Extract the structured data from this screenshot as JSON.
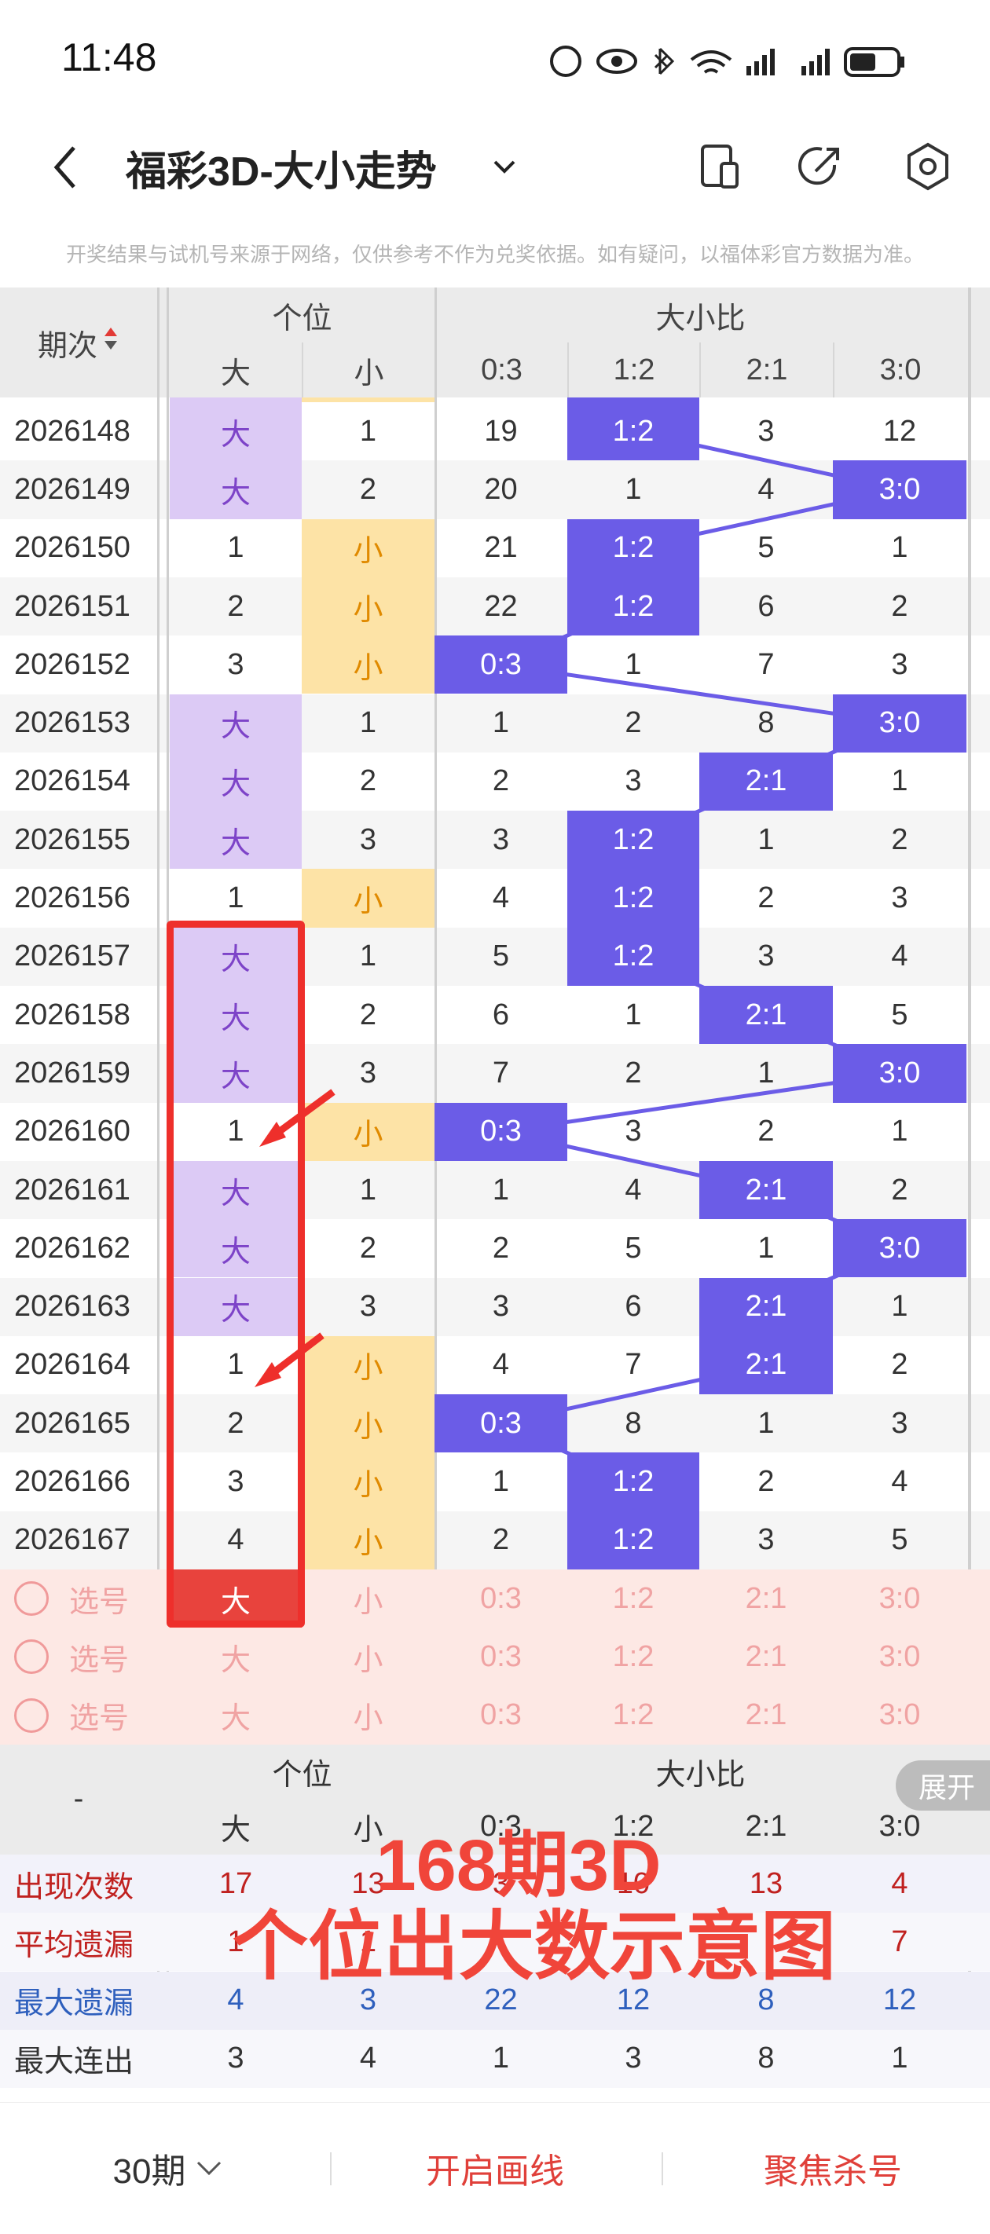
{
  "status_bar": {
    "time": "11:48"
  },
  "nav": {
    "title": "福彩3D-大小走势",
    "back_icon": "chevron-left-icon",
    "icons": [
      "phone-icon",
      "share-icon",
      "settings-hex-icon"
    ]
  },
  "notice": "开奖结果与试机号来源于网络，仅供参考不作为兑奖依据。如有疑问，以福体彩官方数据为准。",
  "table": {
    "period_header": "期次",
    "group_headers": [
      "个位",
      "大小比"
    ],
    "sub_headers": [
      "大",
      "小",
      "0:3",
      "1:2",
      "2:1",
      "3:0"
    ],
    "rows": [
      {
        "period": "2026148",
        "big": "大",
        "small": "1",
        "r03": "19",
        "r12": "1:2",
        "r21": "3",
        "r30": "12",
        "hit": 1
      },
      {
        "period": "2026149",
        "big": "大",
        "small": "2",
        "r03": "20",
        "r12": "1",
        "r21": "4",
        "r30": "3:0",
        "hit": 3
      },
      {
        "period": "2026150",
        "big": "1",
        "small": "小",
        "r03": "21",
        "r12": "1:2",
        "r21": "5",
        "r30": "1",
        "hit": 1
      },
      {
        "period": "2026151",
        "big": "2",
        "small": "小",
        "r03": "22",
        "r12": "1:2",
        "r21": "6",
        "r30": "2",
        "hit": 1
      },
      {
        "period": "2026152",
        "big": "3",
        "small": "小",
        "r03": "0:3",
        "r12": "1",
        "r21": "7",
        "r30": "3",
        "hit": 0
      },
      {
        "period": "2026153",
        "big": "大",
        "small": "1",
        "r03": "1",
        "r12": "2",
        "r21": "8",
        "r30": "3:0",
        "hit": 3
      },
      {
        "period": "2026154",
        "big": "大",
        "small": "2",
        "r03": "2",
        "r12": "3",
        "r21": "2:1",
        "r30": "1",
        "hit": 2
      },
      {
        "period": "2026155",
        "big": "大",
        "small": "3",
        "r03": "3",
        "r12": "1:2",
        "r21": "1",
        "r30": "2",
        "hit": 1
      },
      {
        "period": "2026156",
        "big": "1",
        "small": "小",
        "r03": "4",
        "r12": "1:2",
        "r21": "2",
        "r30": "3",
        "hit": 1
      },
      {
        "period": "2026157",
        "big": "大",
        "small": "1",
        "r03": "5",
        "r12": "1:2",
        "r21": "3",
        "r30": "4",
        "hit": 1
      },
      {
        "period": "2026158",
        "big": "大",
        "small": "2",
        "r03": "6",
        "r12": "1",
        "r21": "2:1",
        "r30": "5",
        "hit": 2
      },
      {
        "period": "2026159",
        "big": "大",
        "small": "3",
        "r03": "7",
        "r12": "2",
        "r21": "1",
        "r30": "3:0",
        "hit": 3
      },
      {
        "period": "2026160",
        "big": "1",
        "small": "小",
        "r03": "0:3",
        "r12": "3",
        "r21": "2",
        "r30": "1",
        "hit": 0
      },
      {
        "period": "2026161",
        "big": "大",
        "small": "1",
        "r03": "1",
        "r12": "4",
        "r21": "2:1",
        "r30": "2",
        "hit": 2
      },
      {
        "period": "2026162",
        "big": "大",
        "small": "2",
        "r03": "2",
        "r12": "5",
        "r21": "1",
        "r30": "3:0",
        "hit": 3
      },
      {
        "period": "2026163",
        "big": "大",
        "small": "3",
        "r03": "3",
        "r12": "6",
        "r21": "2:1",
        "r30": "1",
        "hit": 2
      },
      {
        "period": "2026164",
        "big": "1",
        "small": "小",
        "r03": "4",
        "r12": "7",
        "r21": "2:1",
        "r30": "2",
        "hit": 2
      },
      {
        "period": "2026165",
        "big": "2",
        "small": "小",
        "r03": "0:3",
        "r12": "8",
        "r21": "1",
        "r30": "3",
        "hit": 0
      },
      {
        "period": "2026166",
        "big": "3",
        "small": "小",
        "r03": "1",
        "r12": "1:2",
        "r21": "2",
        "r30": "4",
        "hit": 1
      },
      {
        "period": "2026167",
        "big": "4",
        "small": "小",
        "r03": "2",
        "r12": "1:2",
        "r21": "3",
        "r30": "5",
        "hit": 1
      }
    ],
    "pick_rows": [
      {
        "label": "选号",
        "big": "大",
        "small": "小",
        "r03": "0:3",
        "r12": "1:2",
        "r21": "2:1",
        "r30": "3:0"
      },
      {
        "label": "选号",
        "big": "大",
        "small": "小",
        "r03": "0:3",
        "r12": "1:2",
        "r21": "2:1",
        "r30": "3:0"
      },
      {
        "label": "选号",
        "big": "大",
        "small": "小",
        "r03": "0:3",
        "r12": "1:2",
        "r21": "2:1",
        "r30": "3:0"
      }
    ],
    "footer_dash": "-",
    "expand_label": "展开",
    "stats": [
      {
        "label": "出现次数",
        "values": [
          "17",
          "13",
          "3",
          "10",
          "13",
          "4"
        ]
      },
      {
        "label": "平均遗漏",
        "values": [
          "1",
          "1",
          "",
          "",
          "",
          "7"
        ]
      },
      {
        "label": "最大遗漏",
        "values": [
          "4",
          "3",
          "22",
          "12",
          "8",
          "12"
        ]
      },
      {
        "label": "最大连出",
        "values": [
          "3",
          "4",
          "1",
          "3",
          "8",
          "1"
        ]
      }
    ]
  },
  "overlay": {
    "line1": "168期3D",
    "line2": "个位出大数示意图"
  },
  "bottom_bar": {
    "periods": "30期",
    "draw_line": "开启画线",
    "focus_kill": "聚焦杀号"
  },
  "colors": {
    "purple": "#6b5ce7",
    "lilac": "#dccaf5",
    "yellow": "#fde3a6",
    "pink": "#fde8e4",
    "red": "#f0453a"
  }
}
